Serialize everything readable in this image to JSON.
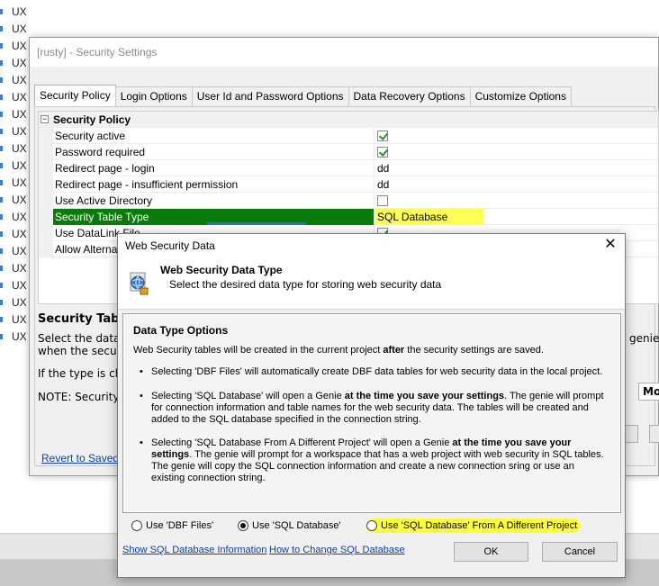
{
  "background_list": {
    "items": [
      "UX",
      "UX",
      "UX",
      "UX",
      "UX",
      "UX",
      "UX",
      "UX",
      "UX",
      "UX",
      "UX",
      "UX",
      "UX",
      "UX",
      "UX",
      "UX",
      "UX",
      "UX",
      "UX",
      "UX"
    ]
  },
  "security_window": {
    "title": "[rusty] - Security Settings",
    "tabs": [
      "Security Policy",
      "Login Options",
      "User Id and Password Options",
      "Data Recovery Options",
      "Customize Options"
    ],
    "category": "Security Policy",
    "rows": [
      {
        "label": "Security active",
        "type": "checkbox",
        "checked": true
      },
      {
        "label": "Password required",
        "type": "checkbox",
        "checked": true
      },
      {
        "label": "Redirect page - login",
        "value": "dd"
      },
      {
        "label": "Redirect page - insufficient permission",
        "value": "dd"
      },
      {
        "label": "Use Active Directory",
        "type": "checkbox",
        "checked": false
      },
      {
        "label": "Security Table Type",
        "value": "SQL Database"
      },
      {
        "label": "Use DataLink File",
        "type": "checkbox",
        "checked": true
      },
      {
        "label": "Allow Alternativ"
      }
    ],
    "description_title": "Security Table",
    "desc_line1": "Select the data",
    "desc_line1_right": "genie",
    "desc_line2": "when the securi",
    "desc_line3": "If the type is ch",
    "desc_line4": "NOTE: Security",
    "more_button": "Mo",
    "revert_link": "Revert to Saved"
  },
  "dialog": {
    "title": "Web Security Data",
    "close_label": "✕",
    "header_title": "Web Security Data Type",
    "header_subtitle": "Select the desired data type for storing web security data",
    "options_title": "Data Type Options",
    "intro_pre": "Web Security tables will be created in the current project ",
    "intro_bold": "after",
    "intro_post": " the security settings are saved.",
    "bullet1": "Selecting 'DBF Files' will automatically create DBF data tables for web security data in the local project.",
    "bullet2_pre": "Selecting 'SQL Database' will open a Genie ",
    "bullet2_bold": "at the time you save your settings",
    "bullet2_post": ". The genie will prompt for connection information and table names for the web security data. The tables will be created and added to the SQL database specified in the connection string.",
    "bullet3_pre": "Selecting 'SQL Database From A Different Project' will open a Genie ",
    "bullet3_bold": "at the time you save your settings",
    "bullet3_post": ". The genie will prompt for a workspace that has a web project with web security in SQL tables. The genie will copy the SQL connection information and create a new connection sring or use an existing connection string.",
    "radio_dbf": "Use 'DBF Files'",
    "radio_sql": "Use 'SQL Database'",
    "radio_diff": "Use 'SQL Database' From A Different Project",
    "selected_option": "Use 'SQL Database'",
    "link_show": "Show SQL Database Information",
    "link_how": "How to Change SQL Database",
    "ok_label": "OK",
    "cancel_label": "Cancel"
  },
  "colors": {
    "selection_green": "#0a7a0a",
    "highlight_yellow": "#ffff55",
    "link_blue": "#0b3fa8"
  }
}
